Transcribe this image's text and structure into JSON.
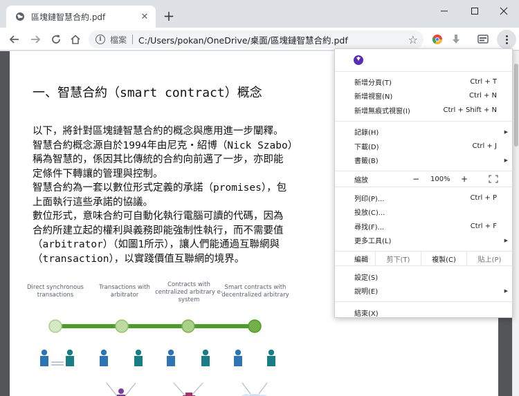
{
  "tab": {
    "title": "區塊鏈智慧合約.pdf",
    "favicon": "globe-icon",
    "close": "✕"
  },
  "newtab": "+",
  "omnibox": {
    "label": "檔案",
    "url": "C:/Users/pokan/OneDrive/桌面/區塊鏈智慧合約.pdf"
  },
  "document": {
    "heading": "一、智慧合約（smart contract）概念",
    "lines": [
      "以下，將針對區塊鏈智慧合約的概念與應用進一步闡釋。",
      "智慧合約概念源自於1994年由尼克・紹博（Nick Szabo）",
      "稱為智慧的，係因其比傳統的合約向前邁了一步，亦即能",
      "定條件下轉讓的管理與控制。",
      "智慧合約為一套以數位形式定義的承諾（promises），包",
      "上面執行這些承諾的協議。",
      "數位形式，意味合約可自動化執行電腦可讀的代碼，因為",
      "合約所建立起的權利與義務即能強制性執行，而不需要值",
      "（arbitrator）（如圖1所示），讓人們能通過互聯網與",
      "（transaction），以實踐價值互聯網的境界。"
    ],
    "figure_labels": [
      "Direct synchronous transactions",
      "Transactions with arbitrator",
      "Contracts with centralized arbitrary e-system",
      "Smart contracts with decentralized arbitrary"
    ]
  },
  "menu": {
    "group1": [
      {
        "label": "新增分頁(T)",
        "shortcut": "Ctrl + T"
      },
      {
        "label": "新增視窗(N)",
        "shortcut": "Ctrl + N"
      },
      {
        "label": "新增無痕式視窗(I)",
        "shortcut": "Ctrl + Shift + N"
      }
    ],
    "group2": [
      {
        "label": "記錄(H)",
        "shortcut": ""
      },
      {
        "label": "下載(D)",
        "shortcut": "Ctrl + J"
      },
      {
        "label": "書籤(B)",
        "shortcut": ""
      }
    ],
    "zoom": {
      "label": "縮放",
      "minus": "−",
      "value": "100%",
      "plus": "+"
    },
    "group3": [
      {
        "label": "列印(P)...",
        "shortcut": "Ctrl + P"
      },
      {
        "label": "投放(C)...",
        "shortcut": ""
      },
      {
        "label": "尋找(F)...",
        "shortcut": "Ctrl + F"
      },
      {
        "label": "更多工具(L)",
        "shortcut": ""
      }
    ],
    "edit": {
      "label": "編輯",
      "cut": "剪下(T)",
      "copy": "複製(C)",
      "paste": "貼上(P)"
    },
    "group4": [
      {
        "label": "設定(S)",
        "shortcut": ""
      },
      {
        "label": "說明(E)",
        "shortcut": ""
      }
    ],
    "exit": {
      "label": "結束(X)"
    }
  },
  "colors": {
    "accent_update": "#5b2bb4",
    "timeline_green": "#4e9a2a",
    "person_blue": "#2e74b5",
    "person_teal": "#1a7c86"
  }
}
